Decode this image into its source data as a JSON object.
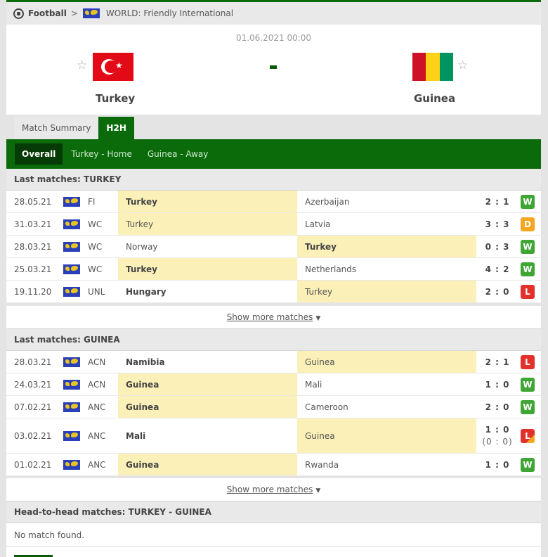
{
  "breadcrumb": {
    "sport": "Football",
    "separator": ">",
    "competition": "WORLD: Friendly International"
  },
  "match": {
    "datetime": "01.06.2021 00:00",
    "score": "-",
    "home": {
      "name": "Turkey",
      "flag_colors": [
        "#e30a17",
        "#ffffff"
      ]
    },
    "away": {
      "name": "Guinea",
      "flag_colors": [
        "#ce1126",
        "#fcd116",
        "#009460"
      ]
    }
  },
  "tabs": [
    {
      "label": "Match Summary",
      "active": false
    },
    {
      "label": "H2H",
      "active": true
    }
  ],
  "subtabs": [
    {
      "label": "Overall",
      "active": true
    },
    {
      "label": "Turkey - Home",
      "active": false
    },
    {
      "label": "Guinea - Away",
      "active": false
    }
  ],
  "sections": [
    {
      "title": "Last matches: TURKEY",
      "show_more": "Show more matches",
      "rows": [
        {
          "date": "28.05.21",
          "comp": "FI",
          "home": "Turkey",
          "away": "Azerbaijan",
          "score": "2 : 1",
          "result": "W"
        },
        {
          "date": "31.03.21",
          "comp": "WC",
          "home": "Turkey",
          "away": "Latvia",
          "score": "3 : 3",
          "result": "D"
        },
        {
          "date": "28.03.21",
          "comp": "WC",
          "home": "Norway",
          "away": "Turkey",
          "score": "0 : 3",
          "result": "W"
        },
        {
          "date": "25.03.21",
          "comp": "WC",
          "home": "Turkey",
          "away": "Netherlands",
          "score": "4 : 2",
          "result": "W"
        },
        {
          "date": "19.11.20",
          "comp": "UNL",
          "home": "Hungary",
          "away": "Turkey",
          "score": "2 : 0",
          "result": "L"
        }
      ]
    },
    {
      "title": "Last matches: GUINEA",
      "show_more": "Show more matches",
      "rows": [
        {
          "date": "28.03.21",
          "comp": "ACN",
          "home": "Namibia",
          "away": "Guinea",
          "score": "2 : 1",
          "result": "L"
        },
        {
          "date": "24.03.21",
          "comp": "ACN",
          "home": "Guinea",
          "away": "Mali",
          "score": "1 : 0",
          "result": "W"
        },
        {
          "date": "07.02.21",
          "comp": "ANC",
          "home": "Guinea",
          "away": "Cameroon",
          "score": "2 : 0",
          "result": "W"
        },
        {
          "date": "03.02.21",
          "comp": "ANC",
          "home": "Mali",
          "away": "Guinea",
          "score": "1 : 0",
          "score_sub": "(0 : 0)",
          "result": "L"
        },
        {
          "date": "01.02.21",
          "comp": "ANC",
          "home": "Guinea",
          "away": "Rwanda",
          "score": "1 : 0",
          "result": "W"
        }
      ]
    }
  ],
  "h2h": {
    "title": "Head-to-head matches: TURKEY - GUINEA",
    "empty_text": "No match found."
  },
  "colors": {
    "brand_green": "#0b6b0b",
    "win": "#3fa535",
    "draw": "#f5a623",
    "loss": "#e2312a",
    "highlight": "#fbf0b8"
  }
}
